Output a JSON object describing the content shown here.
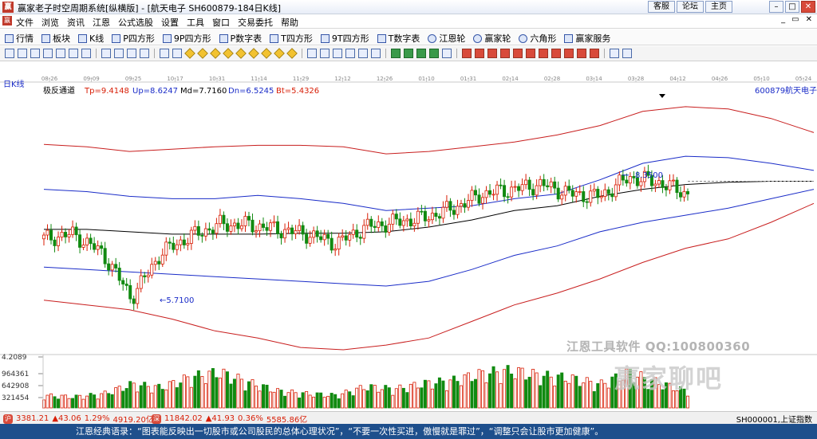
{
  "window": {
    "app_title": "赢家老子时空周期系统[纵横版]",
    "doc_title": "[航天电子  SH600879-184日K线]",
    "links": [
      "客服",
      "论坛",
      "主页"
    ]
  },
  "menu": {
    "items": [
      "文件",
      "浏览",
      "资讯",
      "江恩",
      "公式选股",
      "设置",
      "工具",
      "窗口",
      "交易委托",
      "帮助"
    ]
  },
  "funcbar": {
    "items": [
      "行情",
      "板块",
      "K线",
      "P四方形",
      "9P四方形",
      "P数字表",
      "T四方形",
      "9T四方形",
      "T数字表",
      "江恩轮",
      "赢家轮",
      "六角形",
      "赢家服务"
    ]
  },
  "chart": {
    "period_label": "日K线",
    "indicator_name": "极反通道",
    "indicators": [
      {
        "label": "Tp=9.4148",
        "color": "#d81e06"
      },
      {
        "label": "Up=8.6247",
        "color": "#1a2cc8"
      },
      {
        "label": "Md=7.7160",
        "color": "#000000"
      },
      {
        "label": "Dn=6.5245",
        "color": "#1a2cc8"
      },
      {
        "label": "Bt=5.4326",
        "color": "#d81e06"
      }
    ],
    "stock_code": "600879",
    "stock_name": "航天电子",
    "date_ticks": [
      "08-26",
      "09-09",
      "09-25",
      "10-17",
      "10-31",
      "11-14",
      "11-29",
      "12-12",
      "12-26",
      "01-10",
      "01-31",
      "02-14",
      "02-28",
      "03-14",
      "03-28",
      "04-12",
      "04-26",
      "05-10",
      "05-24"
    ],
    "high_annotation": "8.3500",
    "low_annotation": "5.7100",
    "volume_ticks": [
      "4.2089",
      "964361",
      "642908",
      "321454"
    ],
    "colors": {
      "up": "#d81e06",
      "down": "#108a10",
      "grid": "#c8c8c8"
    }
  },
  "chart_data": {
    "type": "bar",
    "title": "",
    "xlabel": "",
    "ylabel": "",
    "x": [
      "08-26",
      "09-09",
      "09-25",
      "10-17",
      "10-31",
      "11-14",
      "11-29",
      "12-12",
      "12-26",
      "01-10",
      "01-31",
      "02-14",
      "02-28",
      "03-14",
      "03-28",
      "04-12",
      "04-26",
      "05-10",
      "05-24"
    ],
    "series": [
      {
        "name": "Tp",
        "values": [
          9.0,
          8.95,
          8.85,
          8.9,
          8.95,
          8.98,
          8.98,
          8.95,
          8.8,
          8.85,
          8.95,
          9.05,
          9.2,
          9.4,
          9.7,
          9.8,
          9.75,
          9.55,
          9.25
        ]
      },
      {
        "name": "Up",
        "values": [
          8.05,
          8.0,
          7.9,
          7.85,
          7.85,
          7.92,
          7.85,
          7.75,
          7.6,
          7.65,
          7.7,
          7.85,
          7.95,
          8.25,
          8.6,
          8.75,
          8.72,
          8.6,
          8.45
        ]
      },
      {
        "name": "Md",
        "values": [
          7.2,
          7.2,
          7.15,
          7.1,
          7.1,
          7.1,
          7.12,
          7.12,
          7.15,
          7.25,
          7.4,
          7.6,
          7.7,
          7.9,
          8.05,
          8.15,
          8.2,
          8.22,
          8.22
        ]
      },
      {
        "name": "Dn",
        "values": [
          6.4,
          6.35,
          6.3,
          6.25,
          6.2,
          6.15,
          6.1,
          6.05,
          6.0,
          6.1,
          6.35,
          6.65,
          6.85,
          7.15,
          7.35,
          7.5,
          7.65,
          7.85,
          8.05
        ]
      },
      {
        "name": "Bt",
        "values": [
          5.7,
          5.6,
          5.5,
          5.3,
          5.05,
          4.9,
          4.7,
          4.65,
          4.75,
          4.9,
          5.25,
          5.6,
          5.85,
          6.15,
          6.5,
          6.8,
          7.0,
          7.35,
          7.75
        ]
      }
    ],
    "ohlc_close": [
      7.0,
      7.1,
      6.7,
      5.75,
      6.7,
      7.05,
      7.3,
      7.3,
      7.2,
      7.1,
      6.9,
      7.25,
      7.35,
      7.45,
      7.65,
      7.95,
      8.05,
      8.15,
      7.95,
      7.9,
      8.3,
      8.2,
      7.95
    ],
    "volume": [
      320000,
      280000,
      350000,
      600000,
      520000,
      780000,
      910000,
      650000,
      430000,
      360000,
      320000,
      540000,
      480000,
      620000,
      700000,
      880000,
      950000,
      820000,
      760000,
      600000,
      900000,
      640000,
      420000
    ],
    "ylim": [
      4.6,
      10.0
    ],
    "volume_lim": [
      0,
      1100000
    ],
    "grid": true
  },
  "status": {
    "sh_index": "3381.21",
    "sh_change": "▲43.06",
    "sh_pct": "1.29%",
    "sh_amount": "4919.20亿",
    "sz_index": "11842.02",
    "sz_change": "▲41.93",
    "sz_pct": "0.36%",
    "sz_amount": "5585.86亿",
    "right_label": "SH000001,上证指数"
  },
  "quote": {
    "text": "江恩经典语录：“图表能反映出一切股市或公司股民的总体心理状况”，“不要一次性买进，傲慢就是罪过”，“调整只会让股市更加健康”。"
  },
  "watermark": {
    "line1": "江恩工具软件   QQ:100800360",
    "line2": "赢家聊吧"
  }
}
